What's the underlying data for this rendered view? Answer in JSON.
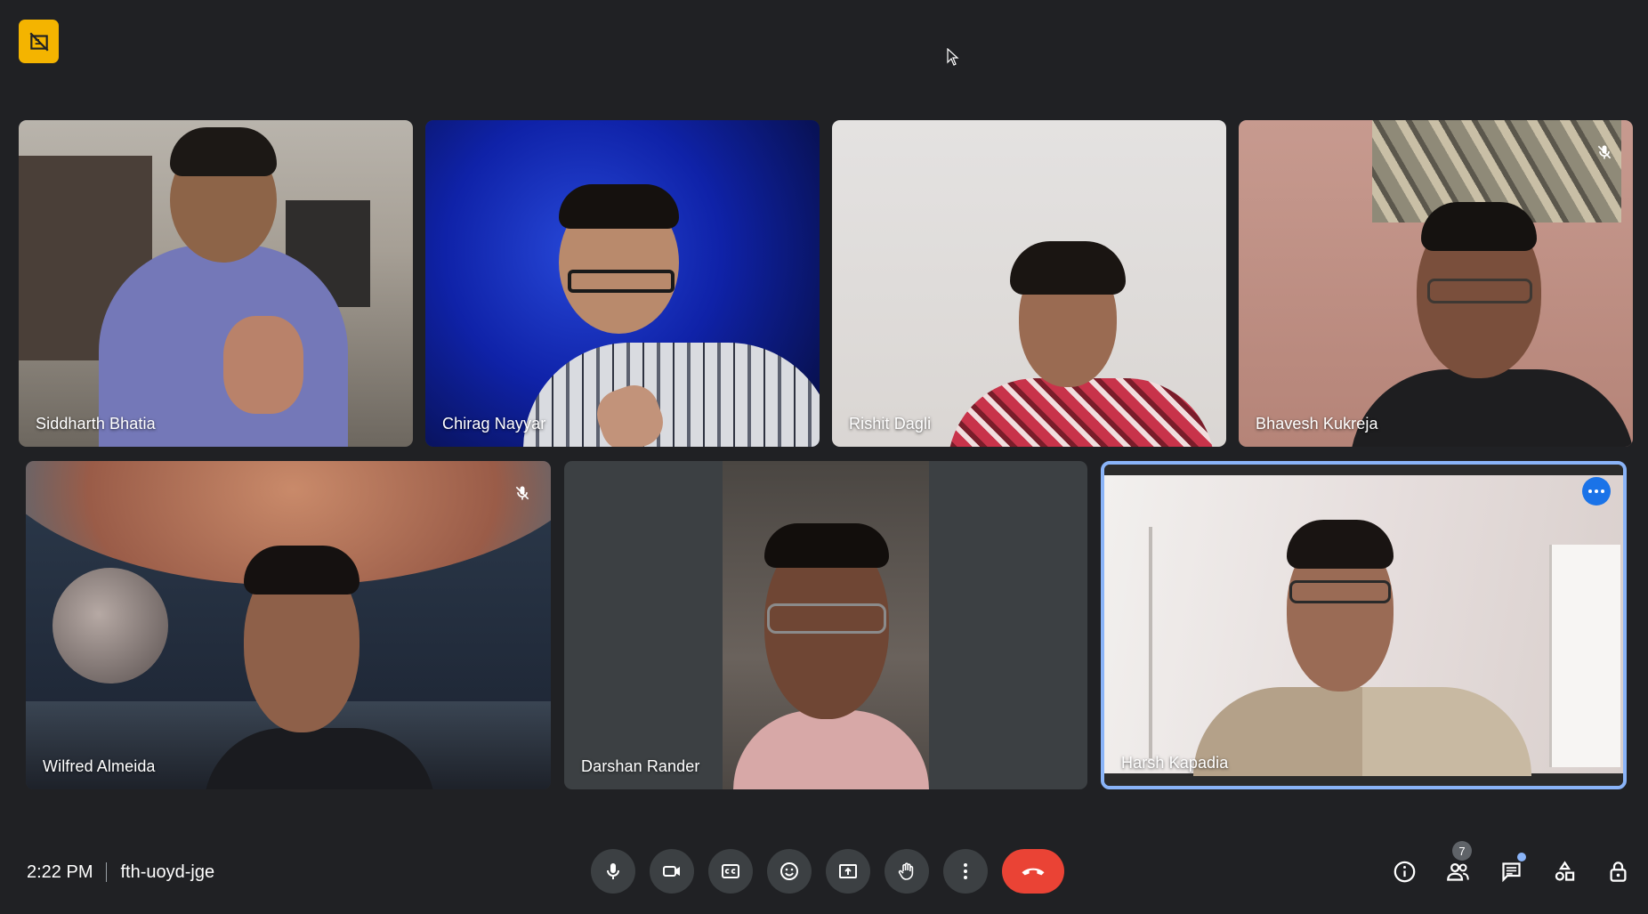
{
  "meeting": {
    "time": "2:22 PM",
    "code": "fth-uoyd-jge",
    "participant_count": "7"
  },
  "participants": [
    {
      "name": "Siddharth Bhatia",
      "muted": false
    },
    {
      "name": "Chirag Nayyar",
      "muted": false
    },
    {
      "name": "Rishit Dagli",
      "muted": false
    },
    {
      "name": "Bhavesh Kukreja",
      "muted": true
    },
    {
      "name": "Wilfred Almeida",
      "muted": true
    },
    {
      "name": "Darshan Rander",
      "muted": false
    },
    {
      "name": "Harsh Kapadia",
      "muted": false,
      "selected": true
    }
  ],
  "controls": [
    "mic-icon",
    "camera-icon",
    "captions-icon",
    "emoji-icon",
    "present-icon",
    "raise-hand-icon",
    "more-options-icon",
    "end-call-icon"
  ],
  "side_panel_icons": [
    "info-icon",
    "people-icon",
    "chat-icon",
    "activities-icon",
    "host-controls-icon"
  ],
  "colors": {
    "accent": "#8ab4f8",
    "end_call": "#ea4335",
    "background": "#202124",
    "tile": "#3c4043"
  }
}
